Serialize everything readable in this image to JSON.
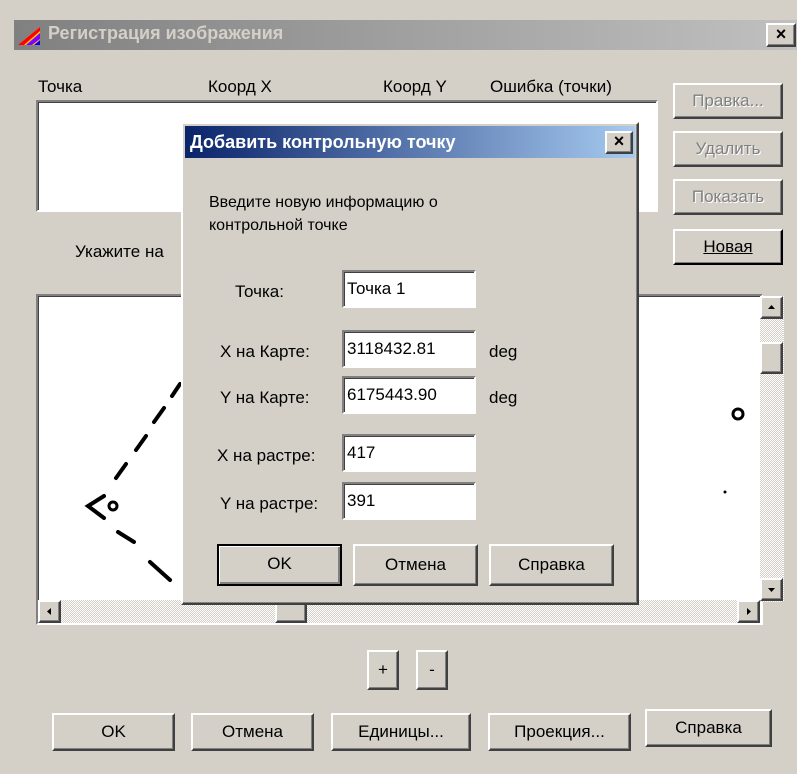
{
  "main_window": {
    "title": "Регистрация изображения",
    "close_glyph": "×",
    "columns": [
      "Точка",
      "Коорд X",
      "Коорд Y",
      "Ошибка (точки)"
    ],
    "side_buttons": {
      "edit": "Правка...",
      "delete": "Удалить",
      "show": "Показать",
      "new": "Новая"
    },
    "instruction": "Укажите на",
    "zoom_in": "+",
    "zoom_out": "-",
    "bottom_buttons": {
      "ok": "OK",
      "cancel": "Отмена",
      "units": "Единицы...",
      "projection": "Проекция...",
      "help": "Справка"
    }
  },
  "dialog": {
    "title": "Добавить контрольную точку",
    "close_glyph": "×",
    "prompt_line1": "Введите новую информацию о",
    "prompt_line2": "контрольной точке",
    "fields": {
      "point_label": "Точка:",
      "point_value": "Точка 1",
      "x_map_label": "X на Карте:",
      "x_map_value": "3118432.81",
      "x_map_unit": "deg",
      "y_map_label": "Y на Карте:",
      "y_map_value": "6175443.90",
      "y_map_unit": "deg",
      "x_raster_label": "X на растре:",
      "x_raster_value": "417",
      "y_raster_label": "Y на растре:",
      "y_raster_value": "391"
    },
    "buttons": {
      "ok": "OK",
      "cancel": "Отмена",
      "help": "Справка"
    }
  },
  "colors": {
    "face": "#d4d0c8",
    "title_inactive": "#808080",
    "title_active_start": "#0a246a",
    "title_active_end": "#a6caf0"
  },
  "icons": [
    "app-icon",
    "close-icon",
    "scroll-up-icon",
    "scroll-down-icon",
    "scroll-left-icon",
    "scroll-right-icon"
  ]
}
